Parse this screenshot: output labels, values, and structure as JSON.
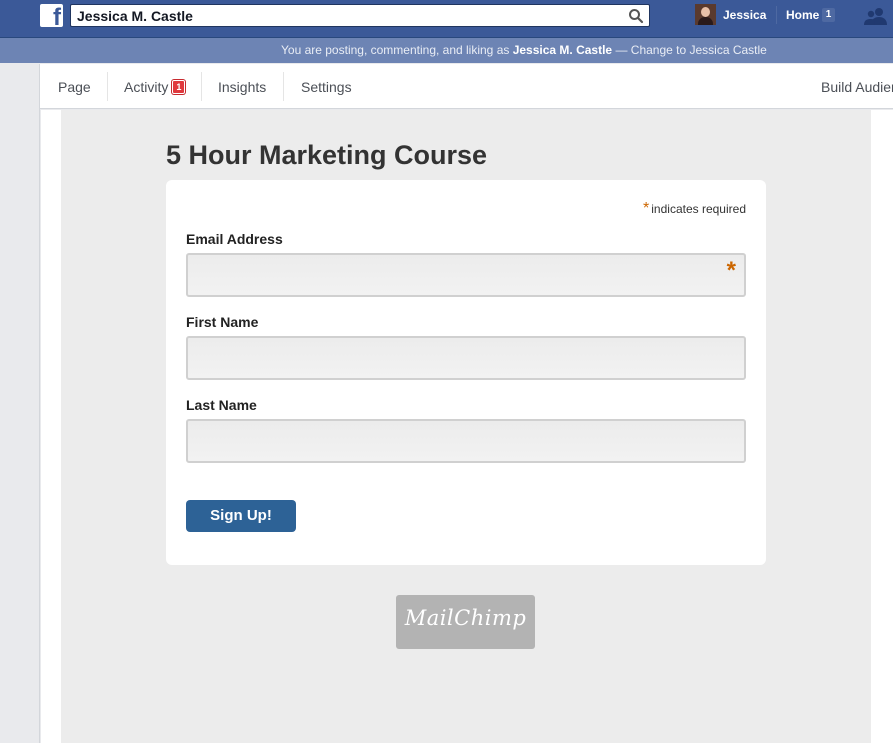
{
  "topbar": {
    "search_value": "Jessica M. Castle",
    "user_name": "Jessica",
    "home_label": "Home",
    "home_count": "1"
  },
  "notice": {
    "prefix": "You are posting, commenting, and liking as ",
    "identity": "Jessica M. Castle",
    "suffix": " — Change to Jessica Castle"
  },
  "page_nav": {
    "items": [
      {
        "label": "Page"
      },
      {
        "label": "Activity",
        "badge": "1"
      },
      {
        "label": "Insights"
      },
      {
        "label": "Settings"
      }
    ],
    "right_label": "Build Audien"
  },
  "form": {
    "title": "5 Hour Marketing Course",
    "required_star": "*",
    "required_note": "indicates required",
    "fields": [
      {
        "label": "Email Address",
        "value": "",
        "required": true
      },
      {
        "label": "First Name",
        "value": ""
      },
      {
        "label": "Last Name",
        "value": ""
      }
    ],
    "submit_label": "Sign Up!"
  },
  "footer": {
    "logo_text": "MailChimp"
  },
  "colors": {
    "facebook_blue": "#3b5998",
    "notice_bar": "#6d84b4",
    "button_blue": "#2d6296",
    "required_orange": "#cc6600"
  },
  "icons": [
    "facebook-logo-icon",
    "search-icon",
    "avatar",
    "friends-icon"
  ]
}
